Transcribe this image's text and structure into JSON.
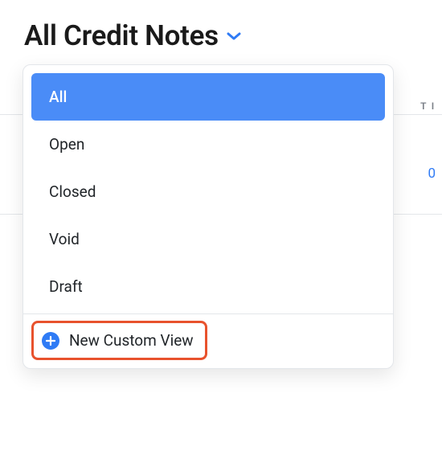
{
  "header": {
    "title": "All Credit Notes"
  },
  "dropdown": {
    "items": [
      {
        "label": "All",
        "selected": true
      },
      {
        "label": "Open",
        "selected": false
      },
      {
        "label": "Closed",
        "selected": false
      },
      {
        "label": "Void",
        "selected": false
      },
      {
        "label": "Draft",
        "selected": false
      }
    ],
    "new_custom_view_label": "New Custom View"
  },
  "background": {
    "column_header_fragment": "T I",
    "link_fragment": "0"
  },
  "colors": {
    "accent": "#2f7bf5",
    "selected_bg": "#4a8cf7",
    "highlight_border": "#e8522d"
  }
}
